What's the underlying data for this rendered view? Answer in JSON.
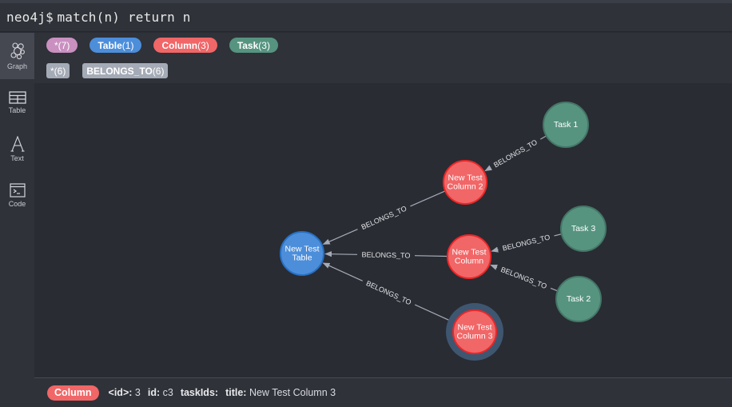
{
  "command": {
    "prompt": "neo4j$",
    "query": "match(n) return n"
  },
  "sidebar": {
    "items": [
      {
        "label": "Graph",
        "icon": "graph-icon",
        "active": true
      },
      {
        "label": "Table",
        "icon": "table-icon",
        "active": false
      },
      {
        "label": "Text",
        "icon": "text-icon",
        "active": false
      },
      {
        "label": "Code",
        "icon": "code-icon",
        "active": false
      }
    ]
  },
  "labels": [
    {
      "name": "*",
      "count": "(7)",
      "color": "#c990c0"
    },
    {
      "name": "Table",
      "count": "(1)",
      "color": "#4c8eda"
    },
    {
      "name": "Column",
      "count": "(3)",
      "color": "#f16667"
    },
    {
      "name": "Task",
      "count": "(3)",
      "color": "#569480"
    }
  ],
  "relationship_types": [
    {
      "name": "*",
      "count": "(6)"
    },
    {
      "name": "BELONGS_TO",
      "count": "(6)"
    }
  ],
  "colors": {
    "table": "#4c8eda",
    "table_stroke": "#2870c2",
    "column": "#f16667",
    "column_stroke": "#eb2728",
    "task": "#569480",
    "task_stroke": "#447666",
    "edge": "#a5abb6",
    "selection_halo": "#3f5670"
  },
  "graph": {
    "nodes": [
      {
        "id": "table",
        "type": "table",
        "lines": [
          "New Test",
          "Table"
        ]
      },
      {
        "id": "col2",
        "type": "column",
        "lines": [
          "New Test",
          "Column 2"
        ]
      },
      {
        "id": "col1",
        "type": "column",
        "lines": [
          "New Test",
          "Column"
        ]
      },
      {
        "id": "col3",
        "type": "column",
        "lines": [
          "New Test",
          "Column 3"
        ],
        "selected": true
      },
      {
        "id": "task1",
        "type": "task",
        "lines": [
          "Task 1"
        ]
      },
      {
        "id": "task3",
        "type": "task",
        "lines": [
          "Task 3"
        ]
      },
      {
        "id": "task2",
        "type": "task",
        "lines": [
          "Task 2"
        ]
      }
    ],
    "edges": [
      {
        "from": "col2",
        "to": "table",
        "label": "BELONGS_TO"
      },
      {
        "from": "col1",
        "to": "table",
        "label": "BELONGS_TO"
      },
      {
        "from": "col3",
        "to": "table",
        "label": "BELONGS_TO"
      },
      {
        "from": "task1",
        "to": "col2",
        "label": "BELONGS_TO"
      },
      {
        "from": "task3",
        "to": "col1",
        "label": "BELONGS_TO"
      },
      {
        "from": "task2",
        "to": "col1",
        "label": "BELONGS_TO"
      }
    ]
  },
  "footer": {
    "label": "Column",
    "properties": [
      {
        "key": "<id>:",
        "value": "3"
      },
      {
        "key": "id:",
        "value": "c3"
      },
      {
        "key": "taskIds:",
        "value": ""
      },
      {
        "key": "title:",
        "value": "New Test Column 3"
      }
    ]
  }
}
